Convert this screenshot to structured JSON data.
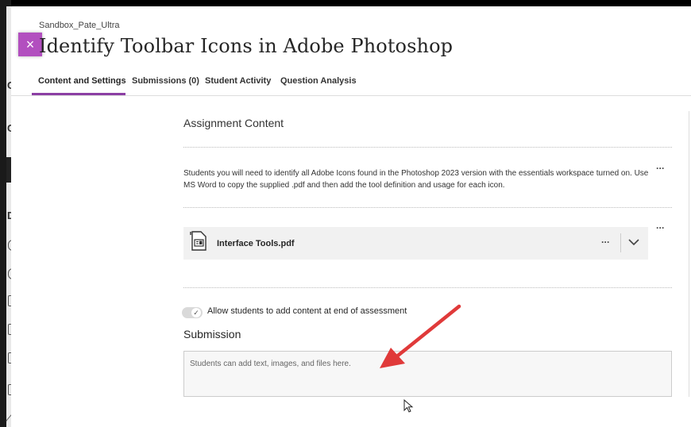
{
  "header": {
    "course_name": "Sandbox_Pate_Ultra",
    "title": "Identify Toolbar Icons in Adobe Photoshop",
    "close_label": "×"
  },
  "tabs": [
    {
      "label": "Content and Settings",
      "active": true
    },
    {
      "label": "Submissions (0)",
      "active": false
    },
    {
      "label": "Student Activity",
      "active": false
    },
    {
      "label": "Question Analysis",
      "active": false
    }
  ],
  "left_panel": {
    "letters": [
      "Co",
      "C",
      "D"
    ]
  },
  "content": {
    "section_title": "Assignment Content",
    "instructions": "Students you will need to identify all Adobe Icons found in the Photoshop 2023 version with the essentials workspace turned on. Use MS Word to copy the supplied .pdf and then add the tool definition and usage for each icon.",
    "more_label": "···",
    "file": {
      "name": "Interface Tools.pdf",
      "more_label": "···"
    },
    "allow_toggle": {
      "label": "Allow students to add content at end of assessment",
      "checked": true
    },
    "submission": {
      "title": "Submission",
      "placeholder": "Students can add text, images, and files here."
    }
  },
  "colors": {
    "accent": "#8c3fa4",
    "close_button": "#b24fbf",
    "annotation_arrow": "#e03a3a"
  }
}
